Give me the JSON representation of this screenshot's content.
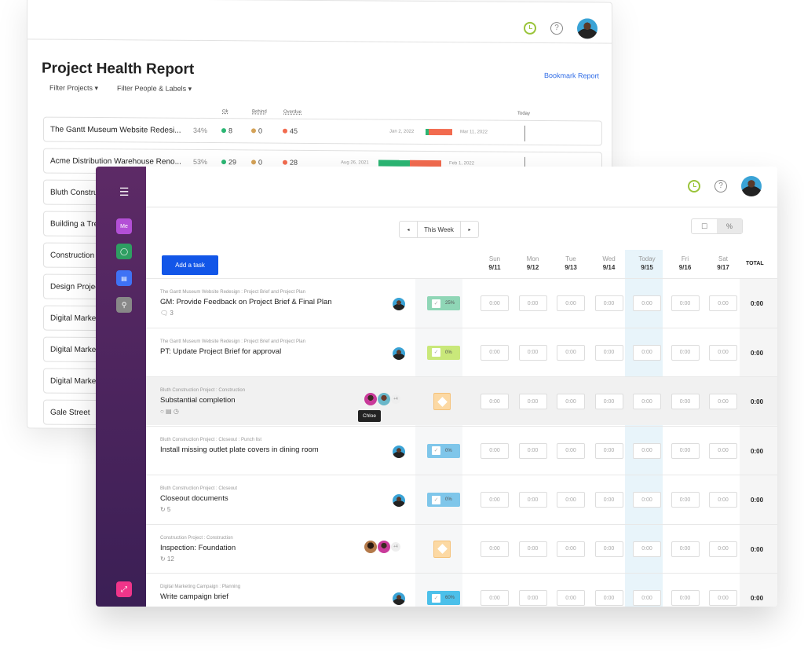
{
  "health_report": {
    "title": "Project Health Report",
    "bookmark_label": "Bookmark Report",
    "filters": [
      "Filter Projects",
      "Filter People & Labels"
    ],
    "columns": {
      "ok": "Ok",
      "behind": "Behind",
      "overdue": "Overdue",
      "today": "Today"
    },
    "status_colors": {
      "ok": "#2bb673",
      "behind": "#d4a257",
      "overdue": "#f26b4f"
    },
    "projects": [
      {
        "name": "The Gantt Museum Website Redesi...",
        "pct": "34%",
        "ok": "8",
        "behind": "0",
        "overdue": "45",
        "start": "Jan 2, 2022",
        "end": "Mar 11, 2022",
        "ok_fraction": 0.12
      },
      {
        "name": "Acme Distribution Warehouse Reno...",
        "pct": "53%",
        "ok": "29",
        "behind": "0",
        "overdue": "28",
        "start": "Aug 26, 2021",
        "end": "Feb 1, 2022",
        "ok_fraction": 0.5
      },
      {
        "name": "Bluth Construc"
      },
      {
        "name": "Building a Tree"
      },
      {
        "name": "Construction P"
      },
      {
        "name": "Design Projec"
      },
      {
        "name": "Digital Marke"
      },
      {
        "name": "Digital Marke"
      },
      {
        "name": "Digital Marke"
      },
      {
        "name": "Gale Street"
      }
    ]
  },
  "sidebar": {
    "items": [
      {
        "icon": "menu-icon"
      },
      {
        "icon": "me-icon",
        "label": "Me",
        "color": "#b34fd6"
      },
      {
        "icon": "chat-icon",
        "color": "#2e9e62"
      },
      {
        "icon": "chart-icon",
        "color": "#3f72f5"
      },
      {
        "icon": "search-icon",
        "color": "#888888"
      },
      {
        "icon": "collapse-icon",
        "color": "#f0358a"
      }
    ]
  },
  "timesheet": {
    "week_label": "This Week",
    "prev": "◂",
    "next": "▸",
    "toggle": [
      "☐",
      "%"
    ],
    "add_task_label": "Add a task",
    "days": [
      {
        "name": "Sun",
        "date": "9/11"
      },
      {
        "name": "Mon",
        "date": "9/12"
      },
      {
        "name": "Tue",
        "date": "9/13"
      },
      {
        "name": "Wed",
        "date": "9/14"
      },
      {
        "name": "Today",
        "date": "9/15"
      },
      {
        "name": "Fri",
        "date": "9/16"
      },
      {
        "name": "Sat",
        "date": "9/17"
      }
    ],
    "total_label": "TOTAL",
    "tooltip": "Chloe",
    "tasks": [
      {
        "crumb": "The Gantt Museum Website Redesign : Project Brief and Project Plan",
        "name": "GM: Provide Feedback on Project Brief & Final Plan",
        "meta": "🗨 3",
        "progress": "25%",
        "progress_color": "#8fd6b6",
        "type": "task",
        "values": [
          "0:00",
          "0:00",
          "0:00",
          "0:00",
          "0:00",
          "0:00",
          "0:00"
        ],
        "total": "0:00"
      },
      {
        "crumb": "The Gantt Museum Website Redesign : Project Brief and Project Plan",
        "name": "PT: Update Project Brief for approval",
        "meta": "",
        "progress": "0%",
        "progress_color": "#c9e87a",
        "type": "task",
        "values": [
          "0:00",
          "0:00",
          "0:00",
          "0:00",
          "0:00",
          "0:00",
          "0:00"
        ],
        "total": "0:00"
      },
      {
        "crumb": "Bluth Construction Project : Construction",
        "name": "Substantial completion",
        "meta": "○  ▤  ◷",
        "extra_assignees": "+4",
        "type": "milestone",
        "values": [
          "0:00",
          "0:00",
          "0:00",
          "0:00",
          "0:00",
          "0:00",
          "0:00"
        ],
        "total": "0:00"
      },
      {
        "crumb": "Bluth Construction Project : Closeout : Punch list",
        "name": "Install missing outlet plate covers in dining room",
        "meta": "",
        "progress": "0%",
        "progress_color": "#7fc6ea",
        "type": "task",
        "values": [
          "0:00",
          "0:00",
          "0:00",
          "0:00",
          "0:00",
          "0:00",
          "0:00"
        ],
        "total": "0:00"
      },
      {
        "crumb": "Bluth Construction Project : Closeout",
        "name": "Closeout documents",
        "meta": "↻ 5",
        "progress": "0%",
        "progress_color": "#7fc6ea",
        "type": "task",
        "values": [
          "0:00",
          "0:00",
          "0:00",
          "0:00",
          "0:00",
          "0:00",
          "0:00"
        ],
        "total": "0:00"
      },
      {
        "crumb": "Construction Project : Construction",
        "name": "Inspection: Foundation",
        "meta": "↻ 12",
        "extra_assignees": "+4",
        "type": "milestone",
        "values": [
          "0:00",
          "0:00",
          "0:00",
          "0:00",
          "0:00",
          "0:00",
          "0:00"
        ],
        "total": "0:00"
      },
      {
        "crumb": "Digital Marketing Campaign : Planning",
        "name": "Write campaign brief",
        "meta": "",
        "progress": "60%",
        "progress_color": "#4cc0ea",
        "type": "task",
        "values": [
          "0:00",
          "0:00",
          "0:00",
          "0:00",
          "0:00",
          "0:00",
          "0:00"
        ],
        "total": "0:00"
      }
    ]
  }
}
